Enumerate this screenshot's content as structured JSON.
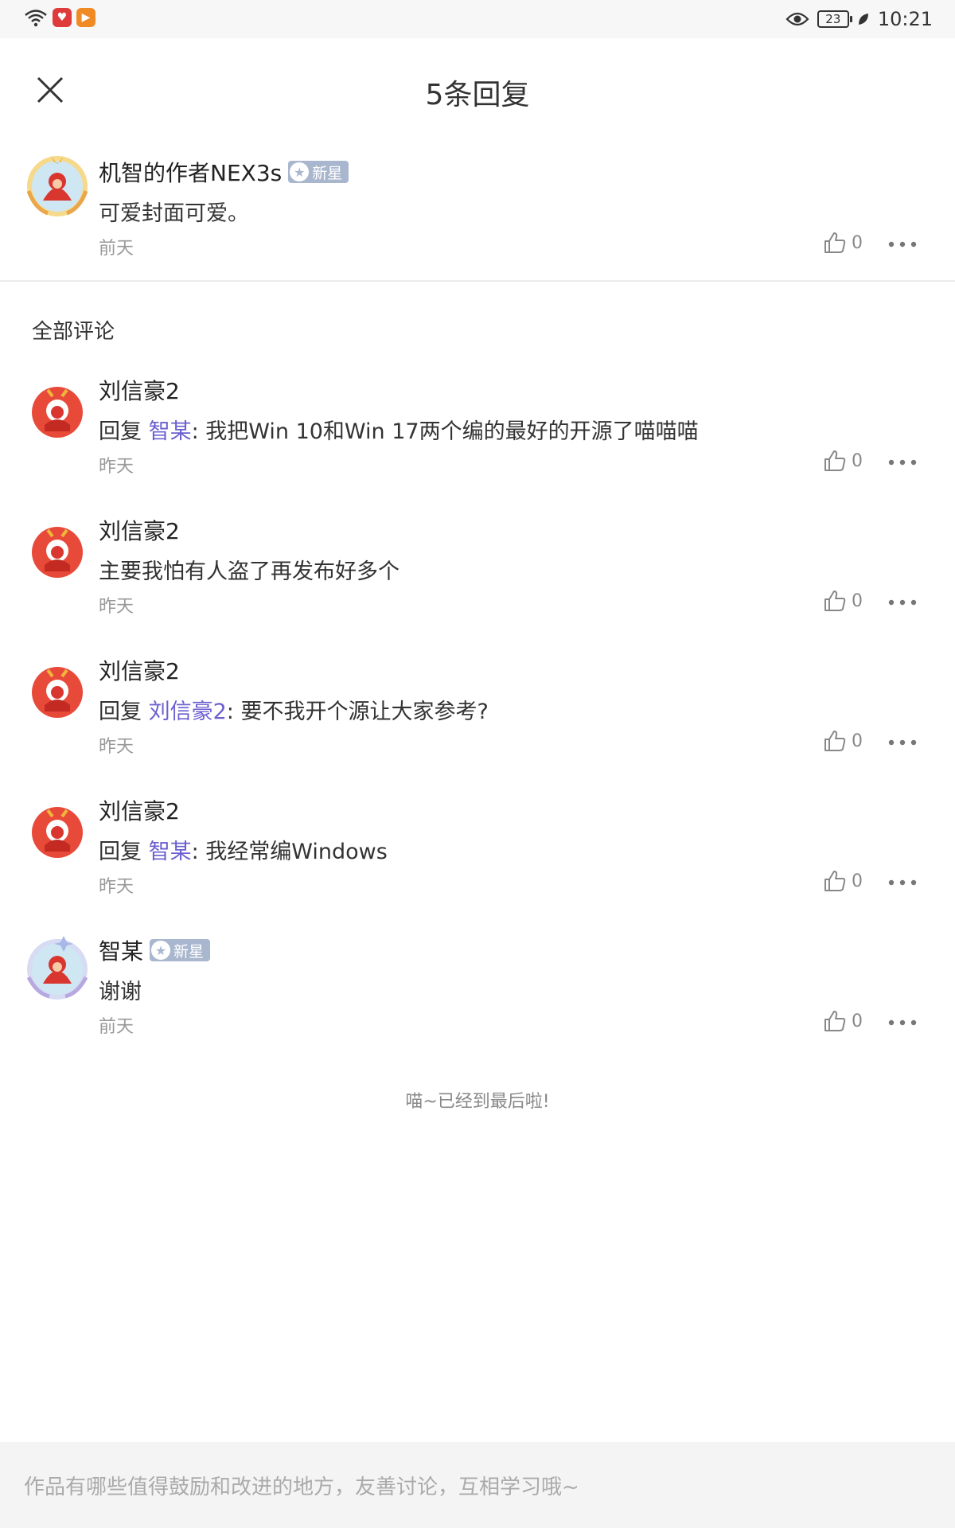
{
  "status_bar": {
    "time": "10:21",
    "battery": "23",
    "app1_color": "#e03b3b",
    "app2_color": "#f08a24"
  },
  "header": {
    "title": "5条回复"
  },
  "original_comment": {
    "username": "机智的作者NEX3s",
    "badge": "新星",
    "text": "可爱封面可爱。",
    "time": "前天",
    "likes": "0"
  },
  "section_title": "全部评论",
  "replies": [
    {
      "username": "刘信豪2",
      "prefix": "回复 ",
      "mention": "智某",
      "text": ": 我把Win 10和Win 17两个编的最好的开源了喵喵喵",
      "time": "昨天",
      "likes": "0"
    },
    {
      "username": "刘信豪2",
      "text": "主要我怕有人盗了再发布好多个",
      "time": "昨天",
      "likes": "0"
    },
    {
      "username": "刘信豪2",
      "prefix": "回复 ",
      "mention": "刘信豪2",
      "text": ": 要不我开个源让大家参考?",
      "time": "昨天",
      "likes": "0"
    },
    {
      "username": "刘信豪2",
      "prefix": "回复 ",
      "mention": "智某",
      "text": ": 我经常编Windows",
      "time": "昨天",
      "likes": "0"
    },
    {
      "username": "智某",
      "badge": "新星",
      "text": "谢谢",
      "time": "前天",
      "likes": "0"
    }
  ],
  "end_text": "喵~已经到最后啦!",
  "input": {
    "placeholder": "作品有哪些值得鼓励和改进的地方，友善讨论，互相学习哦~"
  },
  "colors": {
    "mention": "#6a5fcf",
    "badge": "#a9b7ce"
  }
}
